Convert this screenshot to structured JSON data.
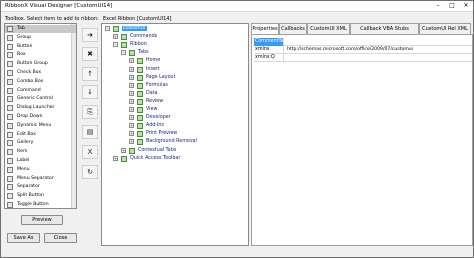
{
  "window": {
    "title": "RibbonX Visual Designer [CustomUI14]",
    "controls": [
      "–",
      "□",
      "✕"
    ]
  },
  "toolbox": {
    "caption": "Toolbox. Select item to add to ribbon:",
    "items": [
      {
        "label": "Tab",
        "icon": "tab-icon"
      },
      {
        "label": "Group",
        "icon": "group-icon"
      },
      {
        "label": "Button",
        "icon": "button-icon"
      },
      {
        "label": "Box",
        "icon": "box-icon"
      },
      {
        "label": "Button Group",
        "icon": "button-group-icon"
      },
      {
        "label": "Check Box",
        "icon": "checkbox-icon"
      },
      {
        "label": "Combo Box",
        "icon": "combobox-icon"
      },
      {
        "label": "Command",
        "icon": "command-icon"
      },
      {
        "label": "Generic Control",
        "icon": "generic-control-icon"
      },
      {
        "label": "Dialog Launcher",
        "icon": "dialog-launcher-icon"
      },
      {
        "label": "Drop Down",
        "icon": "dropdown-icon"
      },
      {
        "label": "Dynamic Menu",
        "icon": "dynamic-menu-icon"
      },
      {
        "label": "Edit Box",
        "icon": "editbox-icon"
      },
      {
        "label": "Gallery",
        "icon": "gallery-icon"
      },
      {
        "label": "Item",
        "icon": "item-icon"
      },
      {
        "label": "Label",
        "icon": "label-icon"
      },
      {
        "label": "Menu",
        "icon": "menu-icon"
      },
      {
        "label": "Menu Separator",
        "icon": "menu-separator-icon"
      },
      {
        "label": "Separator",
        "icon": "separator-icon"
      },
      {
        "label": "Split Button",
        "icon": "split-button-icon"
      },
      {
        "label": "Toggle Button",
        "icon": "toggle-button-icon"
      }
    ],
    "preview_label": "Preview",
    "save_as_label": "Save As",
    "close_label": "Close"
  },
  "side_buttons": [
    {
      "name": "add-arrow-button",
      "glyph": "➜"
    },
    {
      "name": "remove-button",
      "glyph": "✖"
    },
    {
      "name": "move-up-button",
      "glyph": "↑"
    },
    {
      "name": "move-down-button",
      "glyph": "↓"
    },
    {
      "name": "copy-button",
      "glyph": "⎘"
    },
    {
      "name": "paste-button",
      "glyph": "▤"
    },
    {
      "name": "excel-button",
      "glyph": "X"
    },
    {
      "name": "refresh-button",
      "glyph": "↻"
    }
  ],
  "tree": {
    "caption": "Excel Ribbon [CustomUI14]",
    "nodes": [
      {
        "label": "customUI",
        "depth": 0,
        "expand": "−",
        "selected": true
      },
      {
        "label": "Commands",
        "depth": 1,
        "expand": "+"
      },
      {
        "label": "Ribbon",
        "depth": 1,
        "expand": "−"
      },
      {
        "label": "Tabs",
        "depth": 2,
        "expand": "−"
      },
      {
        "label": "Home",
        "depth": 3,
        "expand": "+"
      },
      {
        "label": "Insert",
        "depth": 3,
        "expand": "+"
      },
      {
        "label": "Page Layout",
        "depth": 3,
        "expand": "+"
      },
      {
        "label": "Formulas",
        "depth": 3,
        "expand": "+"
      },
      {
        "label": "Data",
        "depth": 3,
        "expand": "+"
      },
      {
        "label": "Review",
        "depth": 3,
        "expand": "+"
      },
      {
        "label": "View",
        "depth": 3,
        "expand": "+"
      },
      {
        "label": "Developer",
        "depth": 3,
        "expand": "+"
      },
      {
        "label": "Add-Ins",
        "depth": 3,
        "expand": "+"
      },
      {
        "label": "Print Preview",
        "depth": 3,
        "expand": "+"
      },
      {
        "label": "Background Removal",
        "depth": 3,
        "expand": "+"
      },
      {
        "label": "Contextual Tabs",
        "depth": 2,
        "expand": "+"
      },
      {
        "label": "Quick Access Toolbar",
        "depth": 1,
        "expand": "+"
      }
    ]
  },
  "properties": {
    "tabs": [
      "Properties",
      "Callbacks",
      "CustomUI XML",
      "Callback VBA Stubs",
      "CustomUI Rel XML"
    ],
    "active_tab": 0,
    "rows": [
      {
        "key": "CommentText",
        "value": "",
        "header": true
      },
      {
        "key": "xmlns",
        "value": "http://schemas.microsoft.com/office/2009/07/customui"
      },
      {
        "key": "xmlns:Q",
        "value": ""
      }
    ]
  },
  "colors": {
    "selection": "#3399ff",
    "tree_text": "#1a1a7a",
    "node_icon": "#b8e0a8"
  }
}
